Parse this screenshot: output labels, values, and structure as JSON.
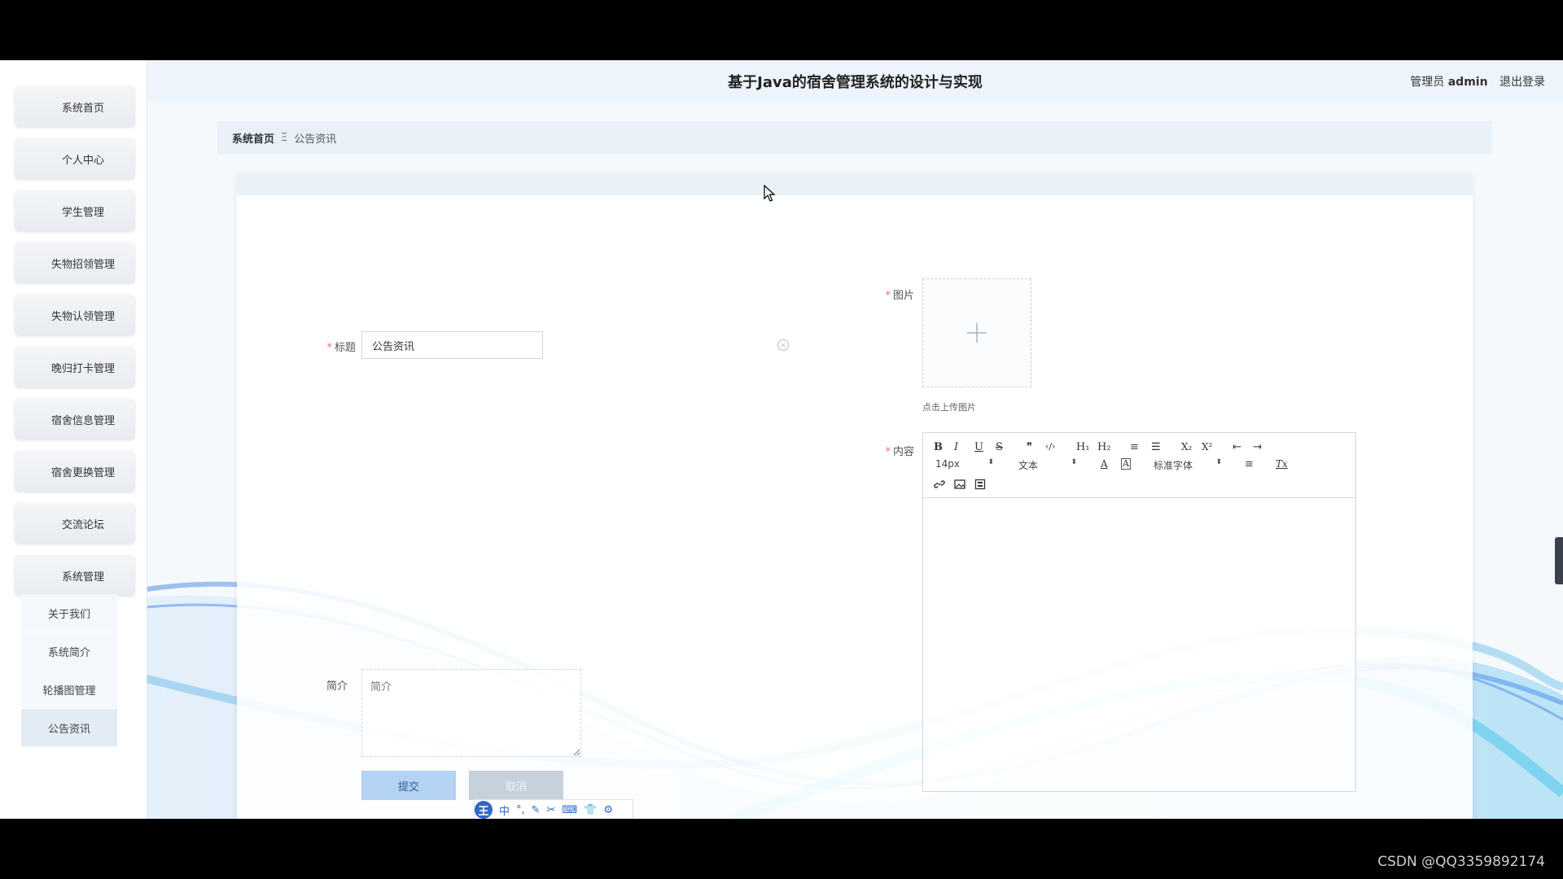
{
  "header": {
    "app_title": "基于Java的宿舍管理系统的设计与实现",
    "user_role": "管理员",
    "user_name": "admin",
    "logout_label": "退出登录"
  },
  "sidebar": {
    "items": [
      {
        "label": "系统首页"
      },
      {
        "label": "个人中心"
      },
      {
        "label": "学生管理"
      },
      {
        "label": "失物招领管理"
      },
      {
        "label": "失物认领管理"
      },
      {
        "label": "晚归打卡管理"
      },
      {
        "label": "宿舍信息管理"
      },
      {
        "label": "宿舍更换管理"
      },
      {
        "label": "交流论坛"
      },
      {
        "label": "系统管理"
      }
    ],
    "submenu": [
      {
        "label": "关于我们"
      },
      {
        "label": "系统简介"
      },
      {
        "label": "轮播图管理"
      },
      {
        "label": "公告资讯",
        "active": true
      }
    ]
  },
  "breadcrumb": {
    "home": "系统首页",
    "separator": "Ξ",
    "current": "公告资讯"
  },
  "form": {
    "title_label": "标题",
    "title_value": "公告资讯",
    "image_label": "图片",
    "upload_hint": "点击上传图片",
    "content_label": "内容",
    "summary_label": "简介",
    "summary_placeholder": "简介",
    "submit_label": "提交",
    "cancel_label": "取消",
    "required_mark": "*"
  },
  "editor": {
    "toolbar": {
      "bold": "B",
      "italic": "I",
      "underline": "U",
      "strike": "S",
      "quote": "❞",
      "code": "‹/›",
      "h1": "H₁",
      "h2": "H₂",
      "ordered_list": "≡",
      "bullet_list": "☰",
      "subscript": "X₂",
      "superscript": "X²",
      "outdent": "⇤",
      "indent": "⇥",
      "font_size": "14px",
      "block_format": "文本",
      "font_color": "A",
      "background_color": "A",
      "font_family": "标准字体",
      "align": "≡",
      "clean": "Tx",
      "select_arrow": "⬍"
    }
  },
  "ime": {
    "badge": "王",
    "mode": "中"
  },
  "watermark": "CSDN @QQ3359892174",
  "colors": {
    "accent": "#b3d2f4",
    "required": "#f56c6c",
    "breadcrumb_bg": "#e8f0f8"
  }
}
